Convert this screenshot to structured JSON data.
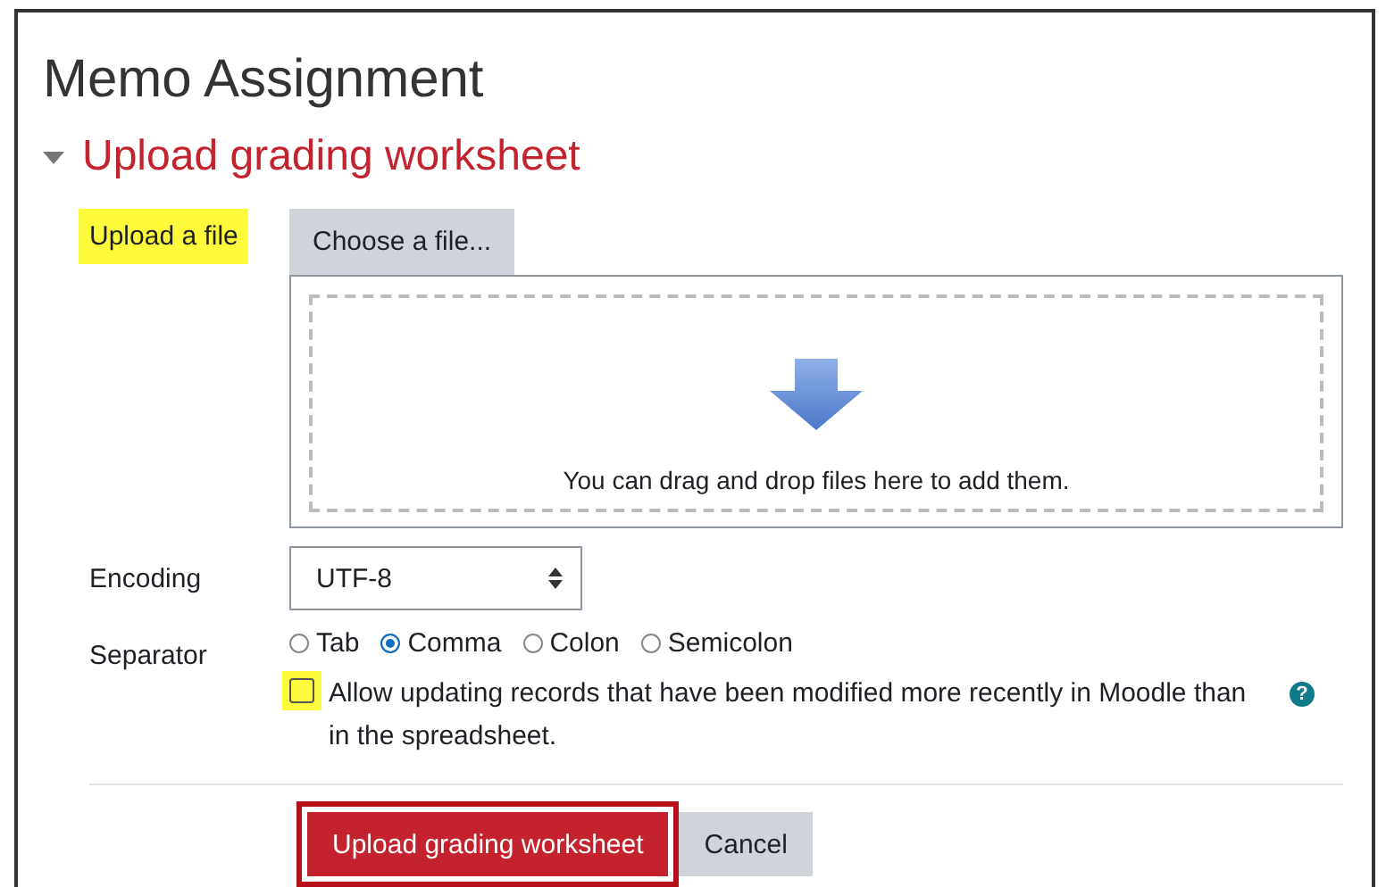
{
  "page_title": "Memo Assignment",
  "section": {
    "title": "Upload grading worksheet",
    "expanded": true
  },
  "file_field": {
    "label": "Upload a file",
    "highlighted": true,
    "button": "Choose a file...",
    "drop_hint": "You can drag and drop files here to add them."
  },
  "encoding": {
    "label": "Encoding",
    "value": "UTF-8"
  },
  "separator": {
    "label": "Separator",
    "options": [
      {
        "label": "Tab",
        "selected": false
      },
      {
        "label": "Comma",
        "selected": true
      },
      {
        "label": "Colon",
        "selected": false
      },
      {
        "label": "Semicolon",
        "selected": false
      }
    ]
  },
  "override": {
    "label": "Allow updating records that have been modified more recently in Moodle than in the spreadsheet.",
    "checked": false,
    "highlighted": true,
    "help": "?"
  },
  "buttons": [
    {
      "label": "Upload grading worksheet",
      "kind": "primary",
      "outlined": true
    },
    {
      "label": "Cancel",
      "kind": "secondary",
      "outlined": false
    }
  ]
}
